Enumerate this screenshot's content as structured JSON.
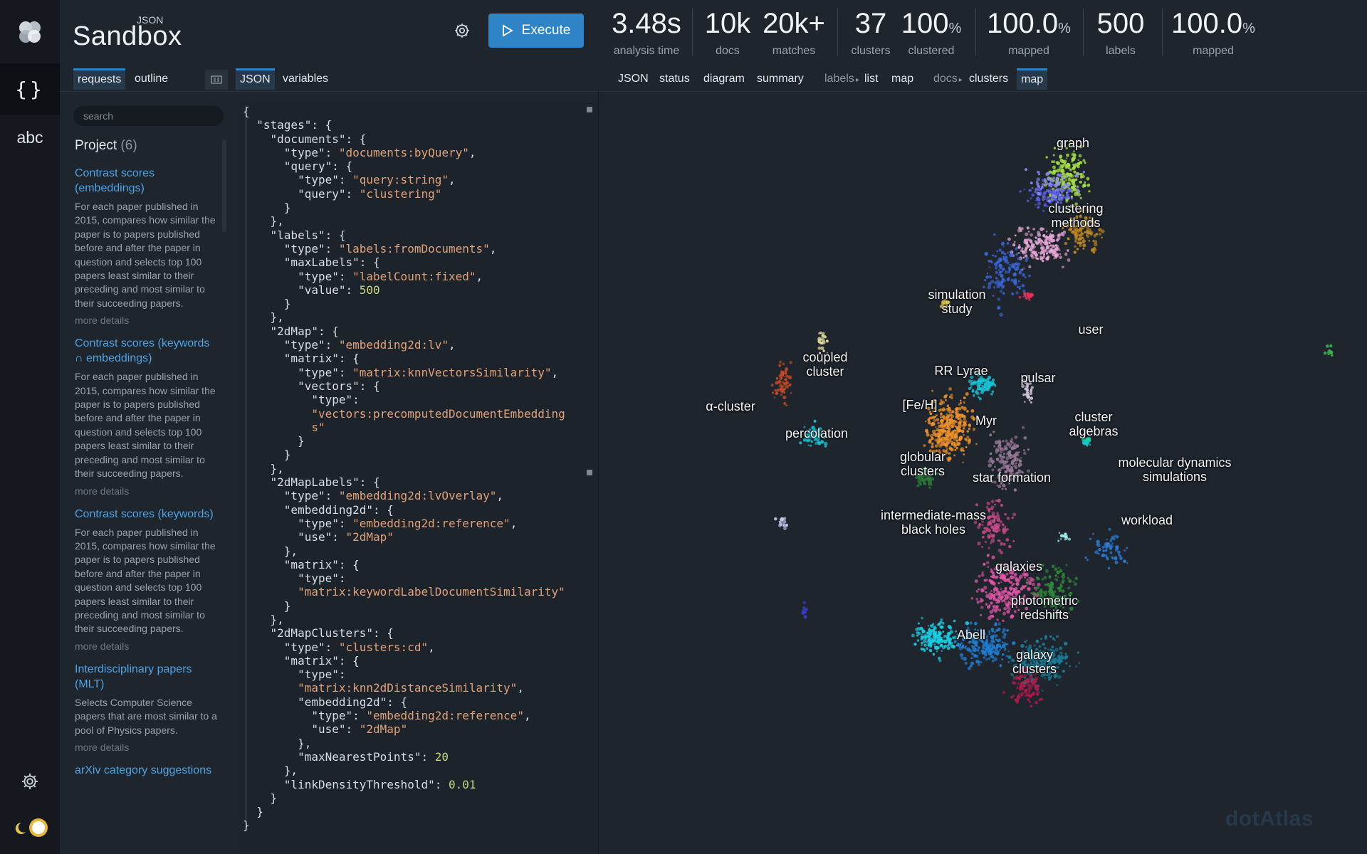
{
  "brand": {
    "super": "JSON",
    "title": "Sandbox"
  },
  "header": {
    "execute_label": "Execute"
  },
  "stats": [
    {
      "value": "3.48s",
      "unit": "",
      "label": "analysis time"
    },
    {
      "value": "10k",
      "unit": "",
      "label": "docs"
    },
    {
      "value": "20k+",
      "unit": "",
      "label": "matches"
    },
    {
      "value": "37",
      "unit": "",
      "label": "clusters"
    },
    {
      "value": "100",
      "unit": "%",
      "label": "clustered"
    },
    {
      "value": "100.0",
      "unit": "%",
      "label": "mapped"
    },
    {
      "value": "500",
      "unit": "",
      "label": "labels"
    },
    {
      "value": "100.0",
      "unit": "%",
      "label": "mapped"
    }
  ],
  "left_tabs": {
    "requests": "requests",
    "outline": "outline"
  },
  "editor_tabs": {
    "json": "JSON",
    "variables": "variables"
  },
  "result_tabs": {
    "json": "JSON",
    "status": "status",
    "diagram": "diagram",
    "summary": "summary",
    "labels": "labels",
    "list": "list",
    "map_labels": "map",
    "docs": "docs",
    "clusters": "clusters",
    "map_docs": "map"
  },
  "search": {
    "placeholder": "search"
  },
  "project": {
    "title": "Project",
    "count": "(6)"
  },
  "queries": [
    {
      "title": "Contrast scores (embeddings)",
      "desc": "For each paper published in 2015, compares how similar the paper is to papers published before and after the paper in question and selects top 100 papers least similar to their preceding and most similar to their succeeding papers.",
      "more": "more details"
    },
    {
      "title": "Contrast scores (keywords ∩ embeddings)",
      "desc": "For each paper published in 2015, compares how similar the paper is to papers published before and after the paper in question and selects top 100 papers least similar to their preceding and most similar to their succeeding papers.",
      "more": "more details"
    },
    {
      "title": "Contrast scores (keywords)",
      "desc": "For each paper published in 2015, compares how similar the paper is to papers published before and after the paper in question and selects top 100 papers least similar to their preceding and most similar to their succeeding papers.",
      "more": "more details"
    },
    {
      "title": "Interdisciplinary papers (MLT)",
      "desc": "Selects Computer Science papers that are most similar to a pool of Physics papers.",
      "more": "more details"
    },
    {
      "title": "arXiv category suggestions",
      "desc": "",
      "more": ""
    }
  ],
  "code_text": [
    "{",
    "  \"stages\": {",
    "    \"documents\": {",
    "      \"type\": \"documents:byQuery\",",
    "      \"query\": {",
    "        \"type\": \"query:string\",",
    "        \"query\": \"clustering\"",
    "      }",
    "    },",
    "    \"labels\": {",
    "      \"type\": \"labels:fromDocuments\",",
    "      \"maxLabels\": {",
    "        \"type\": \"labelCount:fixed\",",
    "        \"value\": 500",
    "      }",
    "    },",
    "    \"2dMap\": {",
    "      \"type\": \"embedding2d:lv\",",
    "      \"matrix\": {",
    "        \"type\": \"matrix:knnVectorsSimilarity\",",
    "        \"vectors\": {",
    "          \"type\":",
    "          \"vectors:precomputedDocumentEmbedding",
    "          s\"",
    "        }",
    "      }",
    "    },",
    "    \"2dMapLabels\": {",
    "      \"type\": \"embedding2d:lvOverlay\",",
    "      \"embedding2d\": {",
    "        \"type\": \"embedding2d:reference\",",
    "        \"use\": \"2dMap\"",
    "      },",
    "      \"matrix\": {",
    "        \"type\":",
    "        \"matrix:keywordLabelDocumentSimilarity\"",
    "      }",
    "    },",
    "    \"2dMapClusters\": {",
    "      \"type\": \"clusters:cd\",",
    "      \"matrix\": {",
    "        \"type\":",
    "        \"matrix:knn2dDistanceSimilarity\",",
    "        \"embedding2d\": {",
    "          \"type\": \"embedding2d:reference\",",
    "          \"use\": \"2dMap\"",
    "        },",
    "        \"maxNearestPoints\": 20",
    "      },",
    "      \"linkDensityThreshold\": 0.01",
    "    }",
    "  }",
    "}"
  ],
  "map_labels": [
    "graph",
    "clustering\nmethods",
    "simulation\nstudy",
    "user",
    "coupled\ncluster",
    "α-cluster",
    "percolation",
    "RR Lyrae",
    "pulsar",
    "[Fe/H]",
    "Myr",
    "cluster\nalgebras",
    "molecular dynamics\nsimulations",
    "globular\nclusters",
    "star formation",
    "intermediate-mass\nblack holes",
    "workload",
    "galaxies",
    "photometric\nredshifts",
    "Abell",
    "galaxy\nclusters"
  ],
  "watermark": "dotAtlas",
  "colors": {
    "accent": "#2f84c8",
    "link": "#4da3e6",
    "background": "#1f252d",
    "rail": "#15191f"
  }
}
